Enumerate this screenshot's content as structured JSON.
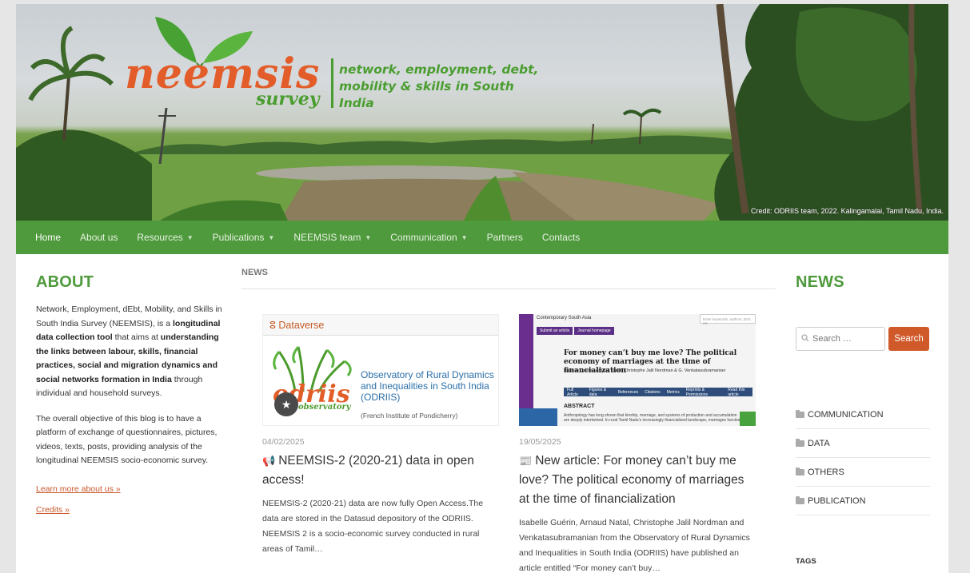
{
  "header": {
    "logo_word": "neemsis",
    "logo_survey": "survey",
    "tagline_line1": "network, employment, debt,",
    "tagline_line2": "mobility & skills in South India",
    "credit": "Credit: ODRIIS team, 2022. Kalingamalai, Tamil Nadu, India."
  },
  "nav": {
    "items": [
      {
        "label": "Home",
        "dropdown": false
      },
      {
        "label": "About us",
        "dropdown": false
      },
      {
        "label": "Resources",
        "dropdown": true
      },
      {
        "label": "Publications",
        "dropdown": true
      },
      {
        "label": "NEEMSIS team",
        "dropdown": true
      },
      {
        "label": "Communication",
        "dropdown": true
      },
      {
        "label": "Partners",
        "dropdown": false
      },
      {
        "label": "Contacts",
        "dropdown": false
      }
    ]
  },
  "about": {
    "title": "ABOUT",
    "p1_a": "Network, Employment, dEbt, Mobility, and Skills in South India Survey (NEEMSIS), is a ",
    "p1_b": "longitudinal data collection tool",
    "p1_c": " that aims at ",
    "p1_d": "understanding the links between labour, skills, financial practices, social and migration dynamics and social networks formation in India",
    "p1_e": " through individual and household surveys.",
    "p2": "The overall objective of this blog is to have a platform of exchange of questionnaires, pictures, videos, texts, posts, providing analysis of the longitudinal NEEMSIS socio-economic survey.",
    "learn_more": "Learn more about us »",
    "credits": "Credits »"
  },
  "center": {
    "label": "NEWS",
    "post1": {
      "date": "04/02/2025",
      "title": "NEEMSIS-2 (2020-21) data in open access!",
      "excerpt": "NEEMSIS-2 (2020-21) data are now fully Open Access.The data are stored in the Datasud depository of the ODRIIS. NEEMSIS 2 is a socio-economic survey conducted in rural areas of Tamil…",
      "thumb": {
        "dataverse": "Dataverse",
        "odriis_word": "odriis",
        "odriis_sub": "observatory",
        "odriis_title": "Observatory of Rural Dynamics and Inequalities in South India (ODRIIS)",
        "odriis_inst": "(French Institute of Pondicherry)"
      }
    },
    "post2": {
      "date": "19/05/2025",
      "title": "New article: For money can’t buy me love? The political economy of marriages at the time of financialization",
      "excerpt": "Isabelle Guérin, Arnaud Natal, Christophe Jalil Nordman and Venkatasubramanian from the Observatory of Rural Dynamics and Inequalities in South India (ODRIIS) have published an article entitled “For money can’t buy…",
      "thumb": {
        "journal": "Contemporary South Asia",
        "search_placeholder": "Enter keywords, authors, DOI, etc",
        "btn1": "Submit an article",
        "btn2": "Journal homepage",
        "article_title": "For money can’t buy me love? The political economy of marriages at the time of financialization",
        "authors": "Isabelle Guérin, Arnaud Natal, Christophe Jalil Nordman & G. Venkatasubramanian",
        "tabs": [
          "Full Article",
          "Figures & data",
          "References",
          "Citations",
          "Metrics",
          "Reprints & Permissions",
          "Read this article"
        ],
        "abstract_label": "ABSTRACT",
        "abstract_text": "Anthropology has long shown that kinship, marriage, and systems of production and accumulation are deeply intertwined. In rural Tamil Nadu’s increasingly financialized landscape, marriages function"
      }
    }
  },
  "right": {
    "title": "NEWS",
    "search_placeholder": "Search …",
    "search_button": "Search",
    "categories": [
      "COMMUNICATION",
      "DATA",
      "OTHERS",
      "PUBLICATION"
    ],
    "tags_label": "TAGS"
  },
  "colors": {
    "brand_green": "#4e9a3c",
    "accent_orange": "#d0592a",
    "logo_orange": "#e35d2a"
  }
}
